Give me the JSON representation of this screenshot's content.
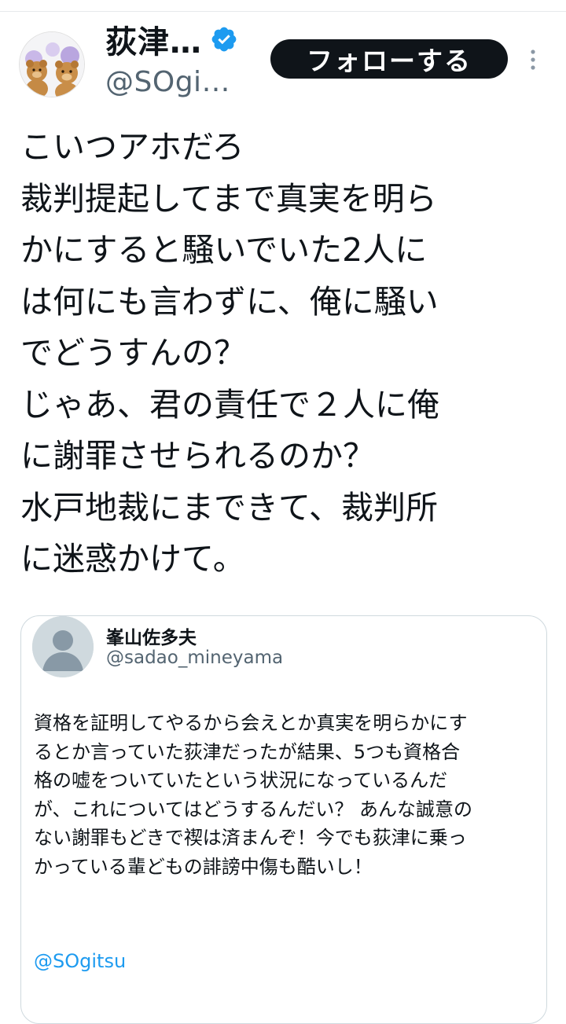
{
  "author": {
    "display_name": "荻津…",
    "handle": "@SOgi…",
    "verified": true,
    "verified_color": "#1d9bf0"
  },
  "header": {
    "follow_label": "フォローする",
    "more_icon": "more-vertical-icon"
  },
  "tweet": {
    "lines": [
      "こいつアホだろ",
      "裁判提起してまで真実を明ら",
      "かにすると騒いでいた2人に",
      "は何にも言わずに、俺に騒い",
      "でどうすんの？",
      "じゃあ、君の責任で２人に俺",
      "に謝罪させられるのか？",
      "水戸地裁にまできて、裁判所",
      "に迷惑かけて。"
    ]
  },
  "quote": {
    "name": "峯山佐多夫",
    "handle": "@sadao_mineyama",
    "lines": [
      "資格を証明してやるから会えとか真実を明らかにす",
      "るとか言っていた荻津だったが結果、5つも資格合",
      "格の嘘をついていたという状況になっているんだ",
      "が、これについてはどうするんだい？ あんな誠意の",
      "ない謝罪もどきで禊は済まんぞ！今でも荻津に乗っ",
      "かっている輩どもの誹謗中傷も酷いし！"
    ],
    "mention": "@SOgitsu",
    "mention_color": "#1d9bf0"
  }
}
